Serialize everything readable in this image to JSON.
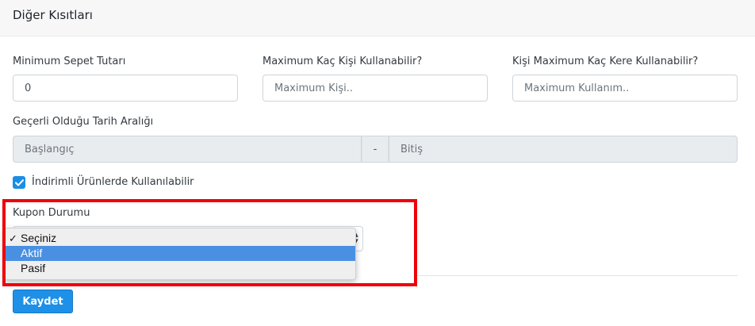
{
  "header": {
    "title": "Diğer Kısıtları"
  },
  "fields": {
    "min_basket": {
      "label": "Minimum Sepet Tutarı",
      "value": "0"
    },
    "max_people": {
      "label": "Maximum Kaç Kişi Kullanabilir?",
      "placeholder": "Maximum Kişi.."
    },
    "max_per_person": {
      "label": "Kişi Maximum Kaç Kere Kullanabilir?",
      "placeholder": "Maximum Kullanım.."
    }
  },
  "date_range": {
    "label": "Geçerli Olduğu Tarih Aralığı",
    "start_placeholder": "Başlangıç",
    "separator": "-",
    "end_placeholder": "Bitiş"
  },
  "discounted_products": {
    "label": "İndirimli Ürünlerde Kullanılabilir",
    "checked": true
  },
  "coupon_status": {
    "label": "Kupon Durumu",
    "selected_mark": "✓",
    "options": [
      "Seçiniz",
      "Aktif",
      "Pasif"
    ],
    "selected": "Seçiniz",
    "highlighted": "Aktif"
  },
  "actions": {
    "save_label": "Kaydet"
  },
  "colors": {
    "accent": "#1e90e8",
    "highlight": "#4a90e2",
    "annotation": "#f0000a"
  },
  "icons": {
    "checkbox": "check-icon",
    "select": "updown-arrows-icon"
  }
}
